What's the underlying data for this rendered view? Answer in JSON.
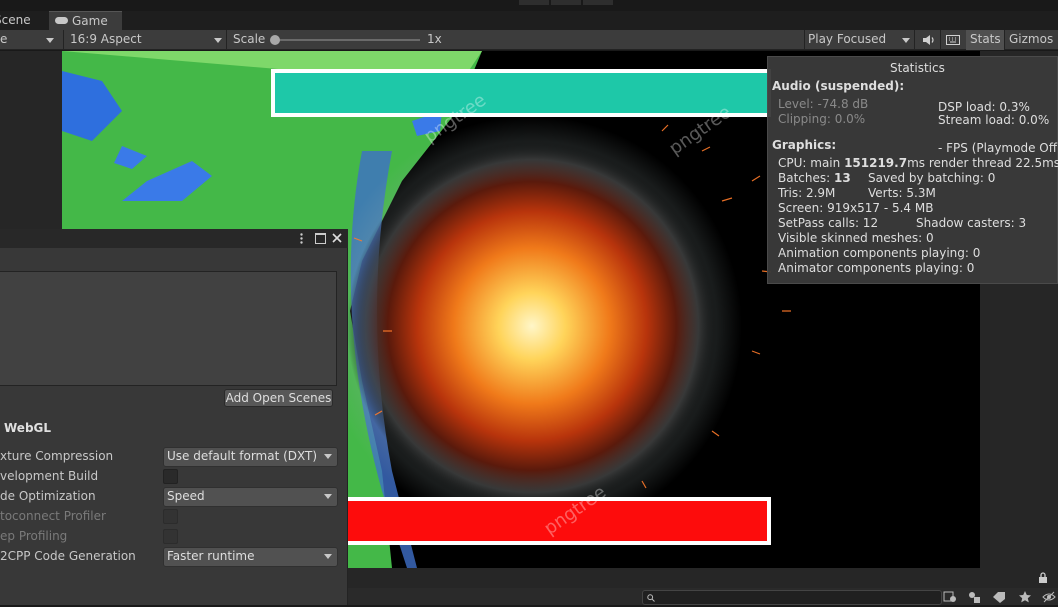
{
  "tabs": {
    "scene": "Scene",
    "game": "Game"
  },
  "toolbar": {
    "display_fragment": "e",
    "aspect": "16:9 Aspect",
    "scale_label": "Scale",
    "scale_value": "1x",
    "play_mode": "Play Focused",
    "stats": "Stats",
    "gizmos": "Gizmos"
  },
  "watermark": "pngtree",
  "statistics": {
    "title": "Statistics",
    "audio_header": "Audio (suspended):",
    "level": "Level: -74.8 dB",
    "clipping": "Clipping: 0.0%",
    "dsp_load": "DSP load: 0.3%",
    "stream_load": "Stream load: 0.0%",
    "graphics_header": "Graphics:",
    "fps": "- FPS (Playmode Off",
    "cpu_prefix": "CPU: main ",
    "cpu_main": "151219.7",
    "cpu_suffix": "ms  render thread 22.5ms",
    "batches_prefix": "Batches: ",
    "batches": "13",
    "saved_batching": "Saved by batching: 0",
    "tris": "Tris: 2.9M",
    "verts": "Verts: 5.3M",
    "screen": "Screen: 919x517 - 5.4 MB",
    "setpass": "SetPass calls: 12",
    "shadow": "Shadow casters: 3",
    "skinned": "Visible skinned meshes: 0",
    "anim": "Animation components playing: 0",
    "animator": "Animator components playing: 0"
  },
  "build_panel": {
    "add_open_scenes": "Add Open Scenes",
    "platform": "WebGL",
    "rows": [
      {
        "label": "xture Compression",
        "type": "dropdown",
        "value": "Use default format (DXT)",
        "enabled": true
      },
      {
        "label": "velopment Build",
        "type": "checkbox",
        "value": "",
        "enabled": true
      },
      {
        "label": "de Optimization",
        "type": "dropdown",
        "value": "Speed",
        "enabled": true
      },
      {
        "label": "toconnect Profiler",
        "type": "checkbox",
        "value": "",
        "enabled": false
      },
      {
        "label": "ep Profiling",
        "type": "checkbox",
        "value": "",
        "enabled": false
      },
      {
        "label": "2CPP Code Generation",
        "type": "dropdown",
        "value": "Faster runtime",
        "enabled": true
      }
    ]
  },
  "colors": {
    "teal_bar": "#1ec8a8",
    "red_bar": "#fd0c0c",
    "panel_bg": "#383838"
  }
}
